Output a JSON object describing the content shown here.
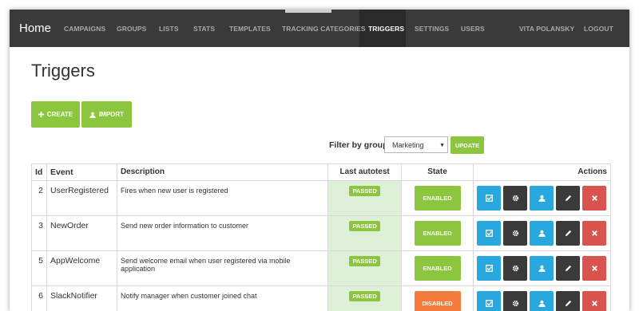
{
  "nav": {
    "brand": "Home",
    "items": [
      "CAMPAIGNS",
      "GROUPS",
      "LISTS",
      "STATS",
      "TEMPLATES",
      "TRACKING CATEGORIES",
      "TRIGGERS",
      "SETTINGS",
      "USERS"
    ],
    "user": "VITA POLANSKY",
    "logout": "LOGOUT",
    "active": "TRIGGERS"
  },
  "page": {
    "title": "Triggers",
    "create_label": "CREATE",
    "import_label": "IMPORT"
  },
  "filter": {
    "label": "Filter by group",
    "selected": "Marketing",
    "update_label": "UPDATE"
  },
  "table": {
    "headers": {
      "id": "Id",
      "event": "Event",
      "description": "Description",
      "last_autotest": "Last autotest",
      "state": "State",
      "actions": "Actions"
    },
    "rows": [
      {
        "id": "2",
        "event": "UserRegistered",
        "description": "Fires when new user is registered",
        "autotest": "PASSED",
        "state": "ENABLED"
      },
      {
        "id": "3",
        "event": "NewOrder",
        "description": "Send new order information to customer",
        "autotest": "PASSED",
        "state": "ENABLED"
      },
      {
        "id": "5",
        "event": "AppWelcome",
        "description": "Send welcome email when user registered via mobile application",
        "autotest": "PASSED",
        "state": "ENABLED"
      },
      {
        "id": "6",
        "event": "SlackNotifier",
        "description": "Notify manager when customer joined chat",
        "autotest": "PASSED",
        "state": "DISABLED"
      }
    ]
  },
  "colors": {
    "green": "#8cc63f",
    "orange": "#f47c3c",
    "blue": "#29a8e0",
    "dark": "#3a3a3a",
    "red": "#d9534f",
    "pass_bg": "#dff0d8"
  },
  "icons": {
    "create": "plus-icon",
    "import": "user-import-icon",
    "row_actions": [
      "check-icon",
      "gear-icon",
      "user-icon",
      "pencil-icon",
      "close-icon"
    ]
  }
}
